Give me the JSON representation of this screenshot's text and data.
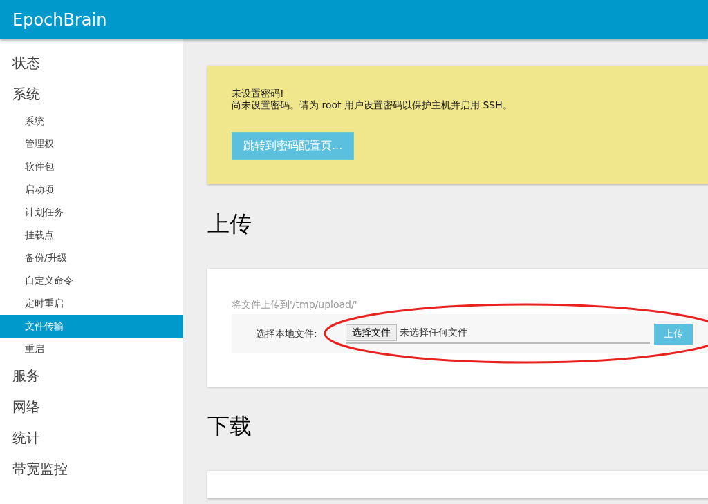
{
  "header": {
    "title": "EpochBrain"
  },
  "sidebar": {
    "items": [
      {
        "label": "状态",
        "selected": false
      },
      {
        "label": "系统",
        "selected": false,
        "children": [
          {
            "label": "系统",
            "selected": false
          },
          {
            "label": "管理权",
            "selected": false
          },
          {
            "label": "软件包",
            "selected": false
          },
          {
            "label": "启动项",
            "selected": false
          },
          {
            "label": "计划任务",
            "selected": false
          },
          {
            "label": "挂载点",
            "selected": false
          },
          {
            "label": "备份/升级",
            "selected": false
          },
          {
            "label": "自定义命令",
            "selected": false
          },
          {
            "label": "定时重启",
            "selected": false
          },
          {
            "label": "文件传输",
            "selected": true
          },
          {
            "label": "重启",
            "selected": false
          }
        ]
      },
      {
        "label": "服务",
        "selected": false
      },
      {
        "label": "网络",
        "selected": false
      },
      {
        "label": "统计",
        "selected": false
      },
      {
        "label": "带宽监控",
        "selected": false
      }
    ]
  },
  "alert": {
    "title": "未设置密码!",
    "message": "尚未设置密码。请为 root 用户设置密码以保护主机并启用 SSH。",
    "button": "跳转到密码配置页..."
  },
  "upload": {
    "heading": "上传",
    "description": "将文件上传到'/tmp/upload/'",
    "field_label": "选择本地文件:",
    "choose_button": "选择文件",
    "file_status": "未选择任何文件",
    "submit_button": "上传"
  },
  "download": {
    "heading": "下载"
  }
}
